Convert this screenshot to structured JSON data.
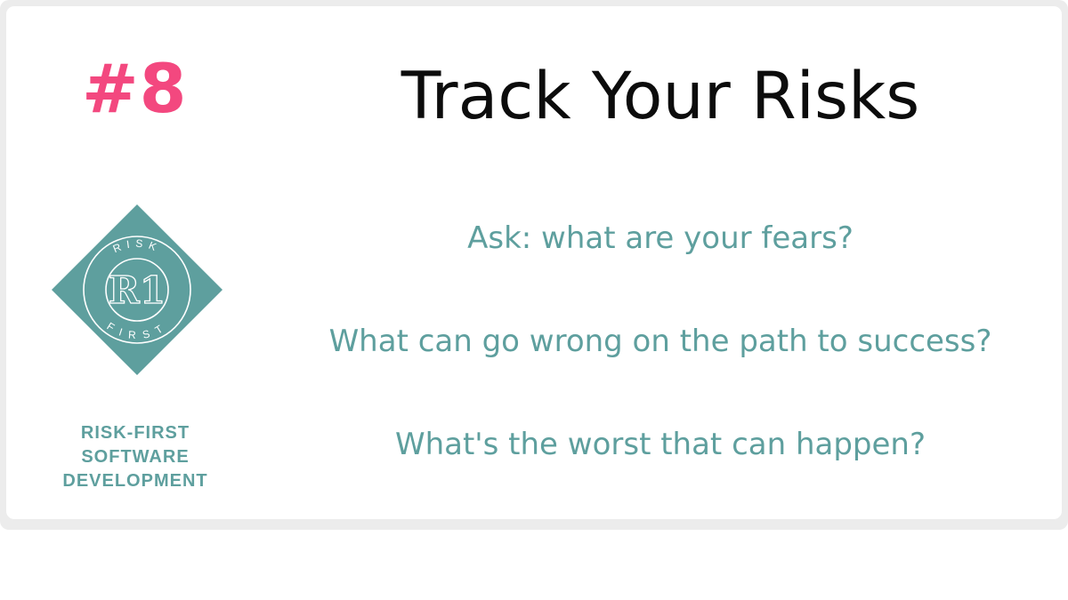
{
  "slide": {
    "number": "#8",
    "title": "Track Your Risks",
    "questions": [
      "Ask: what are your fears?",
      "What can go wrong on the path to success?",
      "What's the worst that can happen?"
    ]
  },
  "brand": {
    "logo_top_text": "RISK",
    "logo_bottom_text": "FIRST",
    "logo_monogram": "R1",
    "lines": [
      "RISK-FIRST",
      "SOFTWARE",
      "DEVELOPMENT"
    ]
  },
  "colors": {
    "accent_pink": "#f3487f",
    "teal": "#5e9f9e",
    "title": "#0c0c0c",
    "frame": "#ececec"
  }
}
